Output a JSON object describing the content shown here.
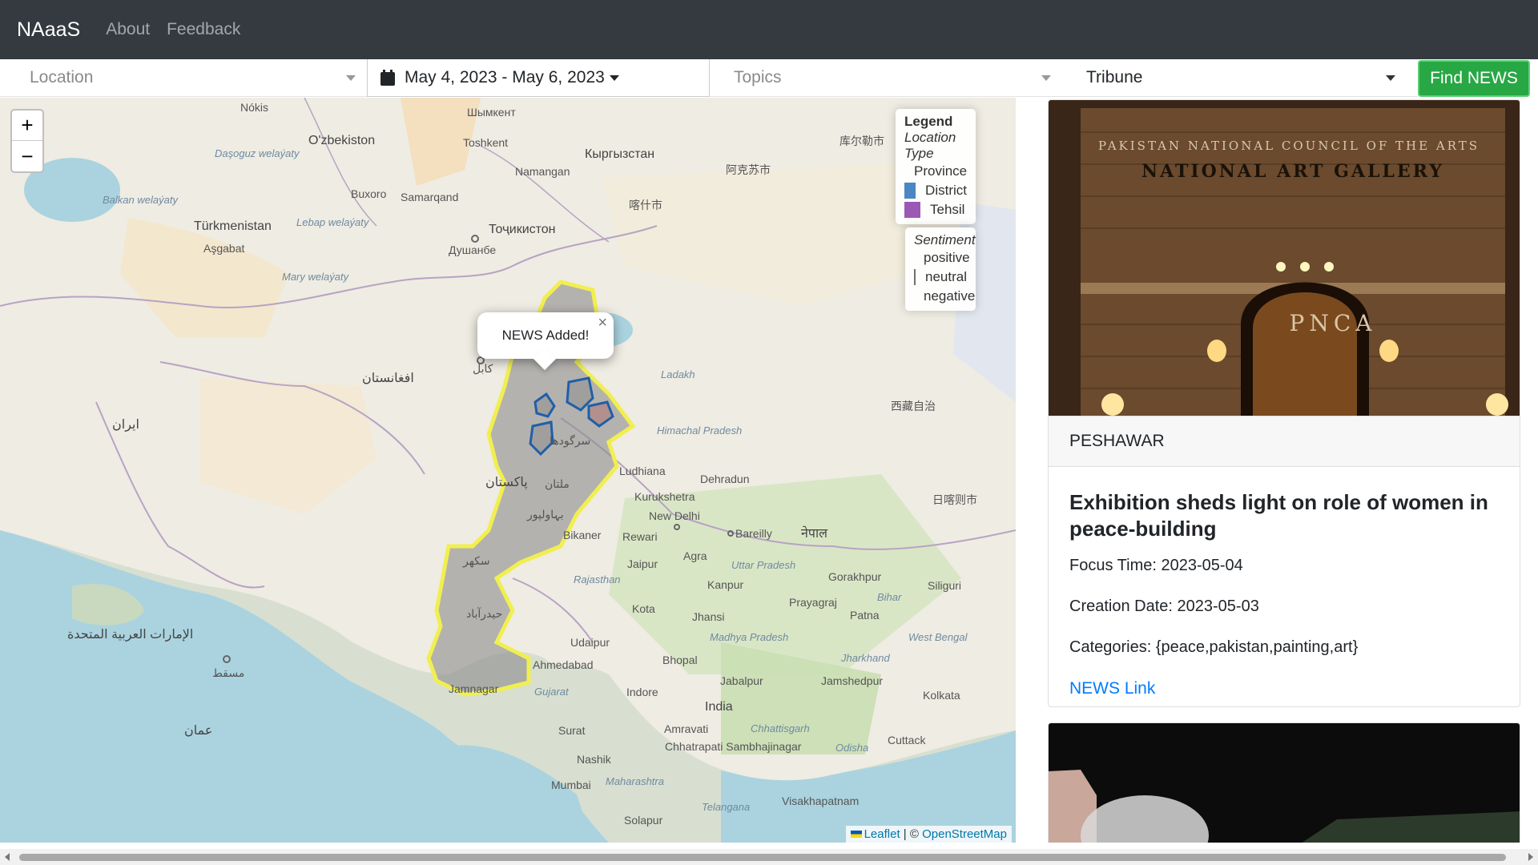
{
  "navbar": {
    "brand": "NAaaS",
    "links": [
      "About",
      "Feedback"
    ]
  },
  "filters": {
    "location_placeholder": "Location",
    "date_range": "May 4, 2023 - May 6, 2023",
    "topics_placeholder": "Topics",
    "source": "Tribune",
    "find_button": "Find NEWS"
  },
  "map": {
    "zoom_in": "+",
    "zoom_out": "−",
    "legend": {
      "title": "Legend",
      "subtitle": "Location Type",
      "items": [
        {
          "label": "Province",
          "color": "#f1ef50"
        },
        {
          "label": "District",
          "color": "#4a87c4"
        },
        {
          "label": "Tehsil",
          "color": "#9b59b6"
        }
      ]
    },
    "sentiment": {
      "title": "Sentiment",
      "items": [
        {
          "label": "positive",
          "color": "#5bc0de"
        },
        {
          "label": "neutral",
          "color": "#707070"
        },
        {
          "label": "negative",
          "color": "#d9534f"
        }
      ]
    },
    "popup": {
      "text": "NEWS Added!",
      "close": "×"
    },
    "attribution": {
      "leaflet": "Leaflet",
      "separator": " | © ",
      "osm": "OpenStreetMap"
    },
    "labels": {
      "nokis": "Nókis",
      "shymkent": "Шымкент",
      "ozbekiston": "O'zbekiston",
      "toshkent": "Toshkent",
      "kyrgyzstan": "Кыргызстан",
      "namangan": "Namangan",
      "dasoguz": "Daşoguz welaýaty",
      "buxoro": "Buxoro",
      "samarqand": "Samarqand",
      "balkan": "Balkan welaýaty",
      "turkmenistan": "Türkmenistan",
      "lebap": "Lebap welaýaty",
      "tojikiston": "Тоҷикистон",
      "dushanbe": "Душанбе",
      "ashgabat": "Aşgabat",
      "mary": "Mary welaýaty",
      "afghanistan": "افغانستان",
      "iran": "ایران",
      "kashgar": "喀什市",
      "aksu": "阿克苏市",
      "ladakh": "Ladakh",
      "himachal": "Himachal Pradesh",
      "ludhiana": "Ludhiana",
      "dehradun": "Dehradun",
      "kurukshetra": "Kurukshetra",
      "newdelhi": "New Delhi",
      "bikaner": "Bikaner",
      "rewari": "Rewari",
      "bareilly": "Bareilly",
      "nepal": "नेपाल",
      "jaipur": "Jaipur",
      "agra": "Agra",
      "uttar": "Uttar Pradesh",
      "rajasthan": "Rajasthan",
      "kanpur": "Kanpur",
      "prayagraj": "Prayagraj",
      "gorakhpur": "Gorakhpur",
      "kota": "Kota",
      "jhansi": "Jhansi",
      "patna": "Patna",
      "udaipur": "Udaipur",
      "madhya": "Madhya Pradesh",
      "ahmedabad": "Ahmedabad",
      "bhopal": "Bhopal",
      "jabalpur": "Jabalpur",
      "jamshedpur": "Jamshedpur",
      "jamnagar": "Jamnagar",
      "gujarat": "Gujarat",
      "indore": "Indore",
      "india": "India",
      "kolkata": "Kolkata",
      "surat": "Surat",
      "amravati": "Amravati",
      "chhattisgarh": "Chhattisgarh",
      "cuttack": "Cuttack",
      "nashik": "Nashik",
      "chhatrapati": "Chhatrapati Sambhajinagar",
      "odisha": "Odisha",
      "mumbai": "Mumbai",
      "maharashtra": "Maharashtra",
      "telangana": "Telangana",
      "visakhapatnam": "Visakhapatnam",
      "solapur": "Solapur",
      "siliguri": "Siliguri",
      "bihar": "Bihar",
      "westbengal": "West Bengal",
      "jharkhand": "Jharkhand",
      "oman": "عمان",
      "uae": "الإمارات العربية المتحدة",
      "muscat": "مسقط",
      "pakistan": "پاکستان",
      "multan": "ملتان",
      "sukkur": "سکھر",
      "hyderabad": "حیدرآباد",
      "bahawalpur": "بہاولپور",
      "sargodha": "سرگودھا",
      "kabul": "کابل",
      "xizang": "西藏自治",
      "rikaze": "日喀则市",
      "hotan": "库尔勒市"
    }
  },
  "news": [
    {
      "location": "PESHAWAR",
      "title": "Exhibition sheds light on role of women in peace-building",
      "focus_time": "Focus Time: 2023-05-04",
      "creation_date": "Creation Date: 2023-05-03",
      "categories": "Categories: {peace,pakistan,painting,art}",
      "link_text": "NEWS Link",
      "image_text_1": "PAKISTAN NATIONAL COUNCIL OF THE ARTS",
      "image_text_2": "NATIONAL ART GALLERY",
      "image_text_3": "PNCA"
    }
  ]
}
